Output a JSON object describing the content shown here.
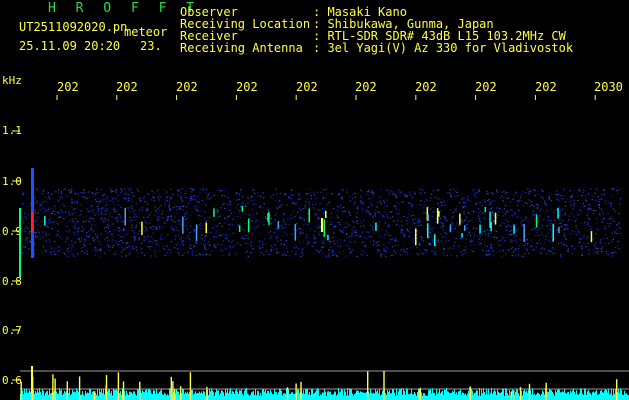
{
  "brand": "H R O F F T",
  "filename": "UT2511092020.pn",
  "meteor_label": "meteor",
  "datetime": "25.11.09 20:20",
  "count": "23.",
  "info": [
    {
      "key": "Observer",
      "value": ": Masaki Kano"
    },
    {
      "key": "Receiving Location",
      "value": ": Shibukawa, Gunma, Japan"
    },
    {
      "key": "Receiver",
      "value": ": RTL-SDR SDR# 43dB L15 103.2MHz CW"
    },
    {
      "key": "Receiving Antenna",
      "value": ": 3el Yagi(V) Az 330 for Vladivostok"
    }
  ],
  "y_unit": "kHz",
  "y_ticks": [
    "1.1",
    "1.0",
    "0.9",
    "0.8",
    "0.7",
    "0.6"
  ],
  "x_ticks": [
    "202",
    "202",
    "202",
    "202",
    "202",
    "202",
    "202",
    "202",
    "202",
    "2030"
  ],
  "colors": {
    "text": "#ffff40",
    "brand": "#22dd44",
    "noise": "#1a2aa0",
    "signal": "#00ffff",
    "hit": "#ff2040"
  }
}
